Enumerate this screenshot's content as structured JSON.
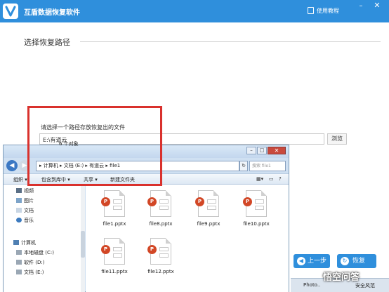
{
  "app": {
    "title": "互盾数据恢复软件",
    "tutorial_label": "使用教程",
    "minimize": "–",
    "close": "✕"
  },
  "page": {
    "title": "选择恢复路径",
    "path_label": "请选择一个路径存放恢复出的文件",
    "path_value": "E:\\有道云",
    "browse_label": "浏览",
    "prev_label": "上一步",
    "next_label": "恢复"
  },
  "explorer": {
    "min": "–",
    "max": "□",
    "close": "✕",
    "address": "▸ 计算机 ▸ 文档 (E:) ▸ 有道云 ▸ file1",
    "search_placeholder": "搜索 file1",
    "toolbar": [
      "组织 ▾",
      "包含到库中 ▾",
      "共享 ▾",
      "新建文件夹"
    ],
    "sidebar": [
      {
        "label": "视频",
        "icon": "video-icon"
      },
      {
        "label": "图片",
        "icon": "picture-icon"
      },
      {
        "label": "文档",
        "icon": "document-icon"
      },
      {
        "label": "音乐",
        "icon": "music-icon"
      },
      {
        "label": "计算机",
        "icon": "computer-icon"
      },
      {
        "label": "本地磁盘 (C:)",
        "icon": "drive-icon"
      },
      {
        "label": "软件 (D:)",
        "icon": "drive-icon"
      },
      {
        "label": "文档 (E:)",
        "icon": "drive-icon"
      }
    ],
    "files": [
      {
        "name": "file1.pptx"
      },
      {
        "name": "file8.pptx"
      },
      {
        "name": "file9.pptx"
      },
      {
        "name": "file10.pptx"
      },
      {
        "name": "file11.pptx"
      },
      {
        "name": "file12.pptx"
      }
    ],
    "status": "6 个对象"
  },
  "taskbar": {
    "left": "Photo..",
    "right": "安全风范"
  },
  "watermark": "悟空问答",
  "colors": {
    "brand_blue": "#2f8fdc",
    "highlight_red": "#d9312d",
    "pptx_orange": "#d24726"
  }
}
